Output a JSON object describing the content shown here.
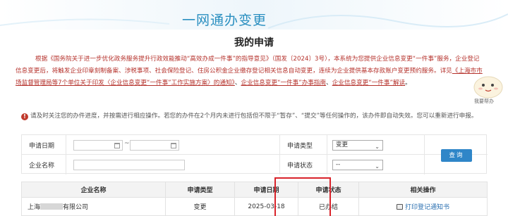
{
  "banner": {
    "title": "一网通办变更"
  },
  "page_title": "我的申请",
  "intro": {
    "p1": "根据《国务院关于进一步优化政务服务提升行政效能推动“高效办成一件事”的指导意见》（国发〔2024〕3号），本系统为您提供企业信息变更“一件事”服务，企业登记信息变更后，将触发企业印章刻制备案、涉税事项、社会保险登记、住房公积金企业缴存登记相关信息自动变更，连续为企业提供基本存款账户变更预约服务。详见",
    "link1": "《上海市市场监督管理局等7个单位关于印发〈企业信息变更“一件事”工作实施方案〉的通知》",
    "sep1": "、",
    "link2": "企业信息变更“一件事”办事指南",
    "sep2": "、",
    "link3": "企业信息变更“一件事”解读",
    "end": "。"
  },
  "help": {
    "label": "我要帮办"
  },
  "notice": {
    "icon": "warning-icon",
    "text": "请及时关注您的办件进度，并按需进行相应操作。若您的办件在2个月内未进行包括但不限于“暂存”、“提交”等任何操作的，该办件即自动失效。您可以重新进行申报。"
  },
  "search": {
    "date_label": "申请日期",
    "date_sep": "~",
    "type_label": "申请类型",
    "type_value": "变更",
    "name_label": "企业名称",
    "status_label": "申请状态",
    "status_value": "--",
    "query_label": "查询"
  },
  "table": {
    "headers": [
      "企业名称",
      "申请类型",
      "申请日期",
      "申请状态",
      "相关操作"
    ],
    "rows": [
      {
        "name": "上海",
        "name_suffix": "有限公司",
        "type": "变更",
        "date": "2025-03-18",
        "status": "已办结",
        "action": "打印登记通知书"
      }
    ]
  }
}
